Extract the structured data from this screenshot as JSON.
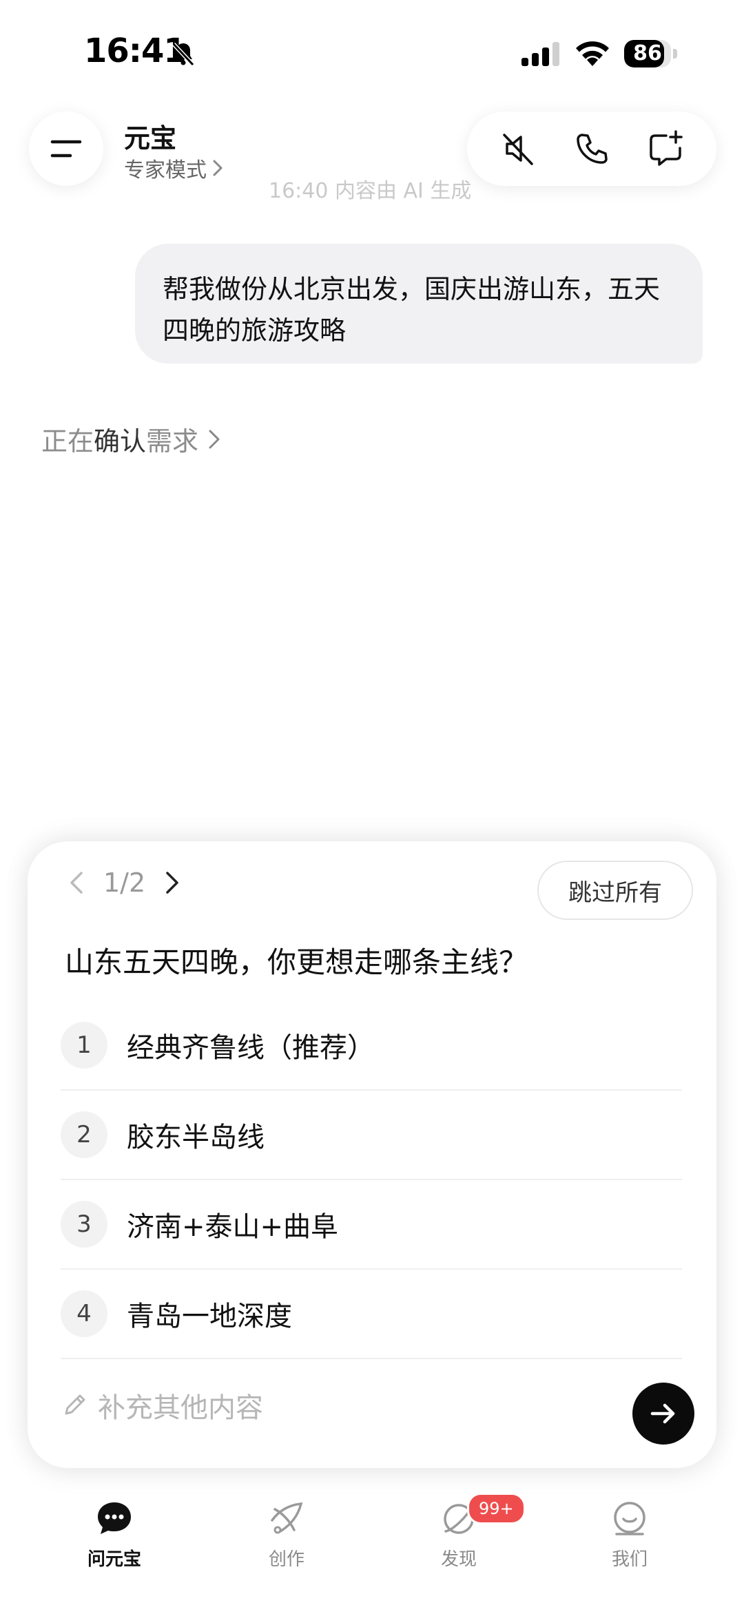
{
  "status_bar": {
    "time": "16:41",
    "battery": "86",
    "battery_level": 0.86
  },
  "header": {
    "title": "元宝",
    "subtitle": "专家模式",
    "timestamp_note": "16:40 内容由 AI 生成",
    "icons": [
      "menu-icon",
      "speaker-mute-icon",
      "phone-icon",
      "new-chat-icon"
    ]
  },
  "chat": {
    "user_message": "帮我做份从北京出发，国庆出游山东，五天四晚的旅游攻略",
    "status_prefix": "正在",
    "status_highlight": "确认",
    "status_suffix": "需求"
  },
  "card": {
    "pager": "1/2",
    "skip_label": "跳过所有",
    "question": "山东五天四晚，你更想走哪条主线？",
    "options": [
      {
        "num": "1",
        "label": "经典齐鲁线（推荐）"
      },
      {
        "num": "2",
        "label": "胶东半岛线"
      },
      {
        "num": "3",
        "label": "济南+泰山+曲阜"
      },
      {
        "num": "4",
        "label": "青岛一地深度"
      }
    ],
    "input_placeholder": "补充其他内容"
  },
  "tabs": [
    {
      "label": "问元宝",
      "active": true
    },
    {
      "label": "创作",
      "active": false
    },
    {
      "label": "发现",
      "active": false,
      "badge": "99+"
    },
    {
      "label": "我们",
      "active": false
    }
  ],
  "colors": {
    "accent_dark": "#0b0b0b",
    "badge_red": "#ef4d4d",
    "bubble_bg": "#f1f1f3"
  }
}
